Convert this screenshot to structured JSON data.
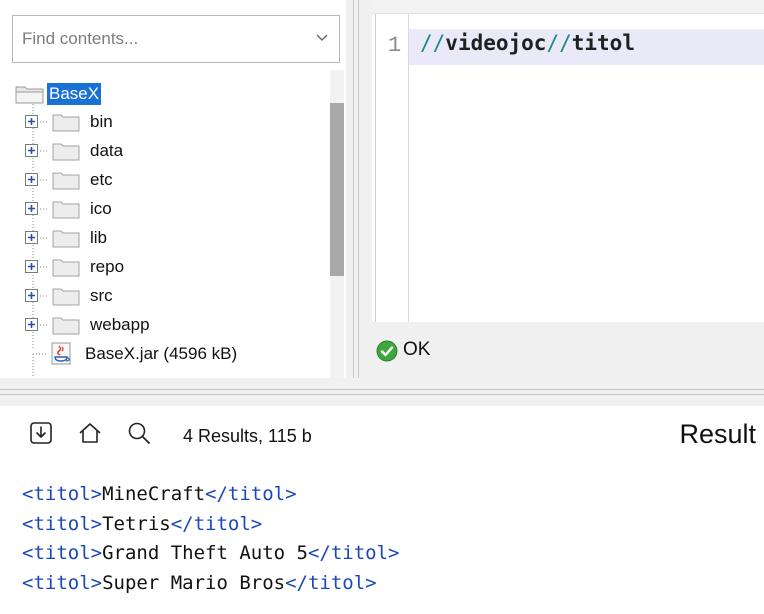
{
  "project": {
    "search_placeholder": "Find contents...",
    "root_label": "BaseX",
    "folders": [
      "bin",
      "data",
      "etc",
      "ico",
      "lib",
      "repo",
      "src",
      "webapp"
    ],
    "file_label": "BaseX.jar (4596 kB)"
  },
  "editor": {
    "line_number": "1",
    "code": {
      "part1": "//",
      "part2": "videojoc",
      "part3": "//",
      "part4": "titol"
    },
    "status": "OK"
  },
  "result": {
    "count": "4 Results, 115 b",
    "title": "Result",
    "tag_open": "<titol>",
    "tag_close": "</titol>",
    "items": [
      "MineCraft",
      "Tetris",
      "Grand Theft Auto 5",
      "Super Mario Bros"
    ]
  },
  "colors": {
    "selection": "#1a71d5",
    "xpath_slash": "#1a8a8a",
    "xml_tag": "#1b48b8",
    "ok_green": "#3fa63f"
  },
  "icons": {
    "folder": "folder-icon",
    "expand": "plus-box-icon",
    "jar": "java-jar-icon",
    "ok": "check-circle-icon",
    "save": "save-icon",
    "home": "home-icon",
    "search": "search-icon",
    "dropdown": "chevron-down-icon"
  }
}
